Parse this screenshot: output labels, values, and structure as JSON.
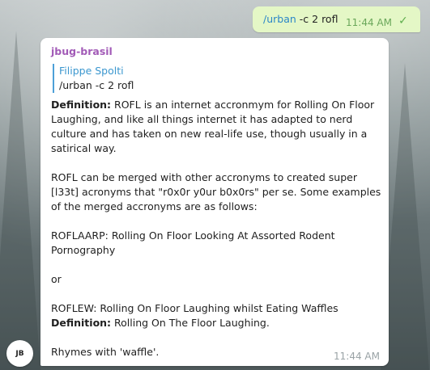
{
  "outgoing": {
    "command_link": "/urban",
    "command_args": "-c 2 rofl",
    "time": "11:44 AM"
  },
  "incoming": {
    "sender": "jbug-brasil",
    "reply": {
      "name": "Filippe Spolti",
      "text": "/urban -c 2 rofl"
    },
    "lines": [
      {
        "bold": "Definition:",
        "text": " ROFL is an internet accronmym for Rolling On Floor Laughing, and like all things internet it has adapted to nerd culture and has taken on new real-life use, though usually in a satirical way."
      },
      {
        "gap": true
      },
      {
        "bold": "",
        "text": "ROFL can be merged with other accronyms to created super [l33t] acronyms that \"r0x0r y0ur b0x0rs\" per se. Some examples of the merged accronyms are as follows:"
      },
      {
        "gap": true
      },
      {
        "bold": "",
        "text": "ROFLAARP: Rolling On Floor Looking At Assorted Rodent Pornography"
      },
      {
        "gap": true
      },
      {
        "bold": "",
        "text": "or"
      },
      {
        "gap": true
      },
      {
        "bold": "",
        "text": "ROFLEW: Rolling On Floor Laughing whilst Eating Waffles"
      },
      {
        "bold": "Definition:",
        "text": " Rolling On The Floor Laughing."
      },
      {
        "gap": true
      },
      {
        "bold": "",
        "text": "Rhymes with 'waffle'."
      }
    ],
    "time": "11:44 AM"
  },
  "avatar": {
    "text": "JB"
  },
  "icons": {
    "read_check": "check-icon"
  }
}
